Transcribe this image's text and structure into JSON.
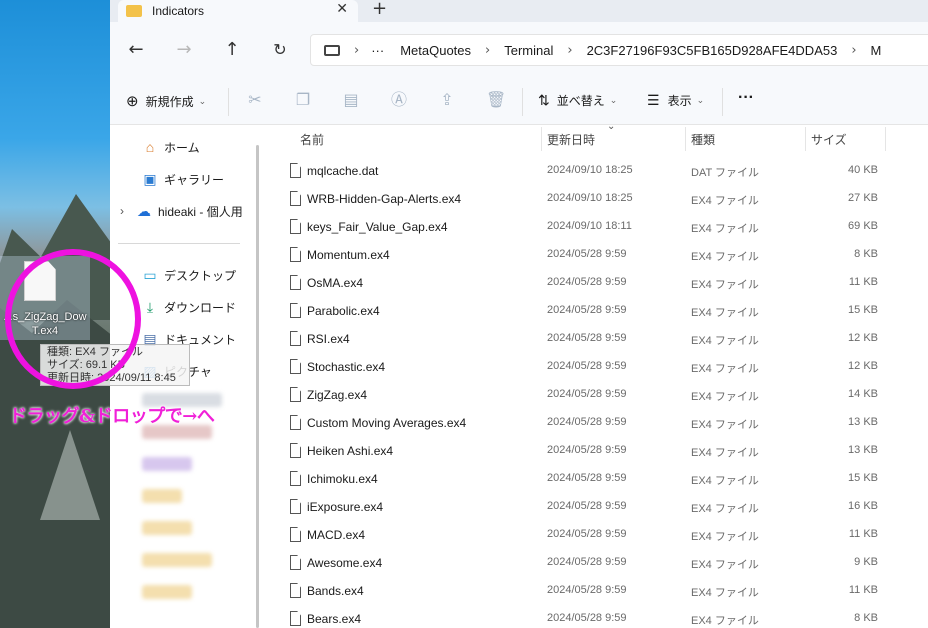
{
  "window": {
    "tab_title": "Indicators",
    "tab_close": "✕",
    "new_tab": "+"
  },
  "address": {
    "more": "···",
    "crumbs": [
      "MetaQuotes",
      "Terminal",
      "2C3F27196F93C5FB165D928AFE4DDA53",
      "M"
    ]
  },
  "toolbar": {
    "new_label": "新規作成",
    "sort_label": "並べ替え",
    "view_label": "表示",
    "more": "···"
  },
  "nav": {
    "home": "ホーム",
    "gallery": "ギャラリー",
    "onedrive": "hideaki - 個人用",
    "desktop": "デスクトップ",
    "downloads": "ダウンロード",
    "documents": "ドキュメント",
    "pictures": "ピクチャ"
  },
  "columns": {
    "name": "名前",
    "date": "更新日時",
    "type": "種類",
    "size": "サイズ"
  },
  "files": [
    {
      "name": "mqlcache.dat",
      "date": "2024/09/10 18:25",
      "type": "DAT ファイル",
      "size": "40 KB"
    },
    {
      "name": "WRB-Hidden-Gap-Alerts.ex4",
      "date": "2024/09/10 18:25",
      "type": "EX4 ファイル",
      "size": "27 KB"
    },
    {
      "name": "keys_Fair_Value_Gap.ex4",
      "date": "2024/09/10 18:11",
      "type": "EX4 ファイル",
      "size": "69 KB"
    },
    {
      "name": "Momentum.ex4",
      "date": "2024/05/28 9:59",
      "type": "EX4 ファイル",
      "size": "8 KB"
    },
    {
      "name": "OsMA.ex4",
      "date": "2024/05/28 9:59",
      "type": "EX4 ファイル",
      "size": "11 KB"
    },
    {
      "name": "Parabolic.ex4",
      "date": "2024/05/28 9:59",
      "type": "EX4 ファイル",
      "size": "15 KB"
    },
    {
      "name": "RSI.ex4",
      "date": "2024/05/28 9:59",
      "type": "EX4 ファイル",
      "size": "12 KB"
    },
    {
      "name": "Stochastic.ex4",
      "date": "2024/05/28 9:59",
      "type": "EX4 ファイル",
      "size": "12 KB"
    },
    {
      "name": "ZigZag.ex4",
      "date": "2024/05/28 9:59",
      "type": "EX4 ファイル",
      "size": "14 KB"
    },
    {
      "name": "Custom Moving Averages.ex4",
      "date": "2024/05/28 9:59",
      "type": "EX4 ファイル",
      "size": "13 KB"
    },
    {
      "name": "Heiken Ashi.ex4",
      "date": "2024/05/28 9:59",
      "type": "EX4 ファイル",
      "size": "13 KB"
    },
    {
      "name": "Ichimoku.ex4",
      "date": "2024/05/28 9:59",
      "type": "EX4 ファイル",
      "size": "15 KB"
    },
    {
      "name": "iExposure.ex4",
      "date": "2024/05/28 9:59",
      "type": "EX4 ファイル",
      "size": "16 KB"
    },
    {
      "name": "MACD.ex4",
      "date": "2024/05/28 9:59",
      "type": "EX4 ファイル",
      "size": "11 KB"
    },
    {
      "name": "Awesome.ex4",
      "date": "2024/05/28 9:59",
      "type": "EX4 ファイル",
      "size": "9 KB"
    },
    {
      "name": "Bands.ex4",
      "date": "2024/05/28 9:59",
      "type": "EX4 ファイル",
      "size": "11 KB"
    },
    {
      "name": "Bears.ex4",
      "date": "2024/05/28 9:59",
      "type": "EX4 ファイル",
      "size": "8 KB"
    }
  ],
  "drag": {
    "file_name": "...s_ZigZag_Dow T.ex4",
    "tip_type": "種類: EX4 ファイル",
    "tip_size": "サイズ: 69.1 KB",
    "tip_date": "更新日時: 2024/09/11 8:45",
    "caption": "ドラッグ&ドロップで→へ"
  },
  "colors": {
    "accent_pink": "#ee12e0",
    "folder": "#f3c24a"
  }
}
